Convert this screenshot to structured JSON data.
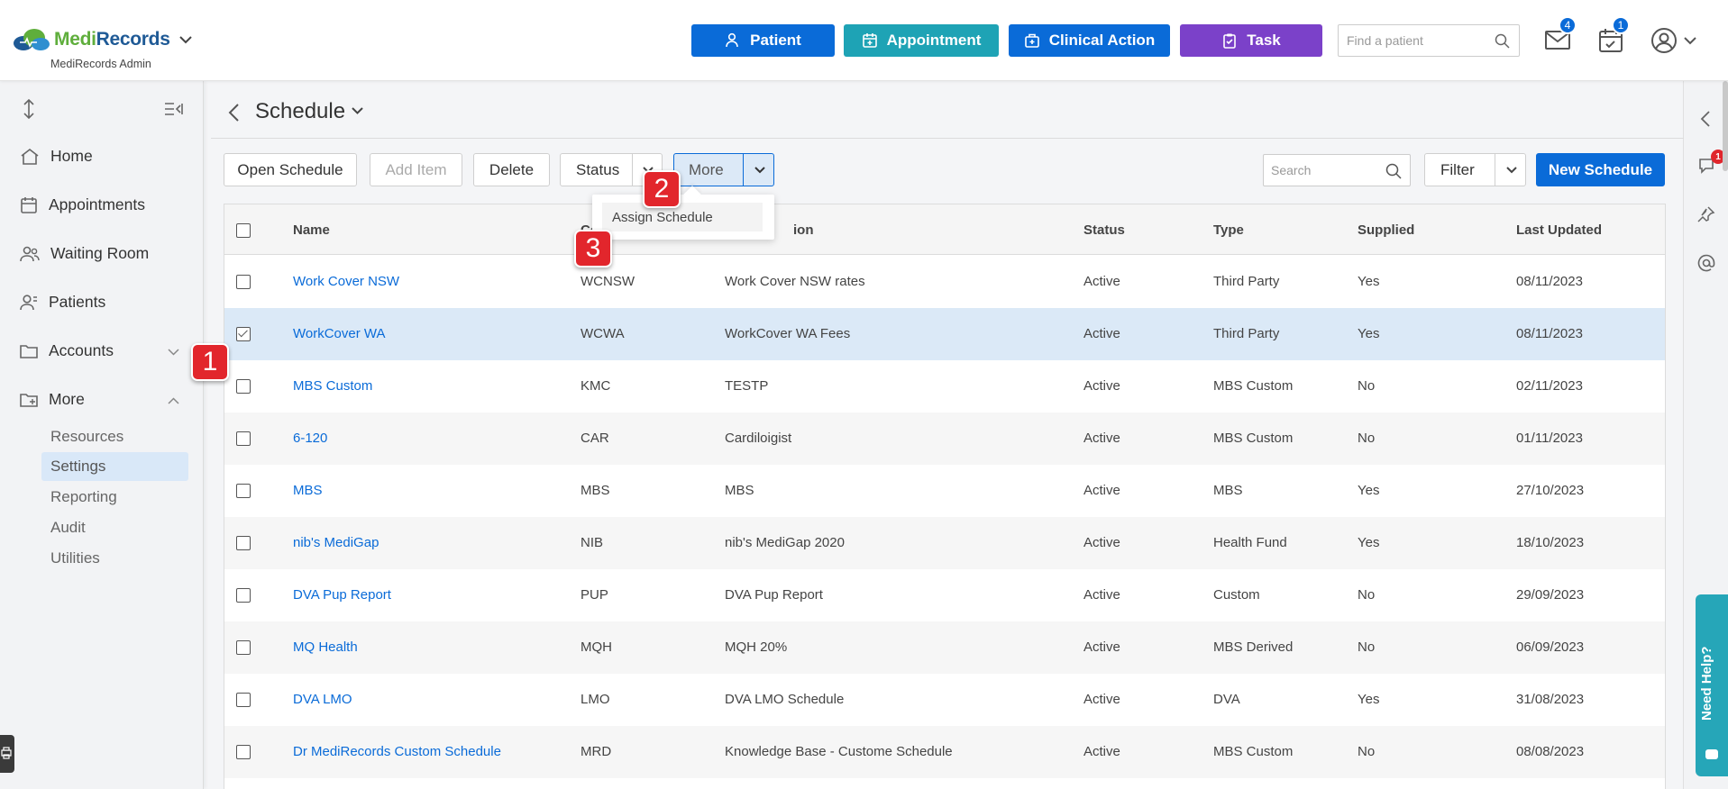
{
  "app": {
    "brand_part1": "Medi",
    "brand_part2": "Records",
    "subtitle": "MediRecords Admin"
  },
  "header": {
    "buttons": [
      {
        "label": "Patient",
        "color": "#0a6bd8"
      },
      {
        "label": "Appointment",
        "color": "#1ea3b5"
      },
      {
        "label": "Clinical Action",
        "color": "#0a6bd8"
      },
      {
        "label": "Task",
        "color": "#7b41c9"
      }
    ],
    "find_placeholder": "Find a patient",
    "mail_badge": "4",
    "calendar_badge": "1"
  },
  "sidebar": {
    "items": [
      {
        "label": "Home",
        "icon": "home-icon"
      },
      {
        "label": "Appointments",
        "icon": "calendar-icon"
      },
      {
        "label": "Waiting Room",
        "icon": "people-icon"
      },
      {
        "label": "Patients",
        "icon": "person-icon"
      },
      {
        "label": "Accounts",
        "icon": "folder-icon"
      },
      {
        "label": "More",
        "icon": "folder-plus-icon"
      }
    ],
    "sub_items": [
      {
        "label": "Resources"
      },
      {
        "label": "Settings"
      },
      {
        "label": "Reporting"
      },
      {
        "label": "Audit"
      },
      {
        "label": "Utilities"
      }
    ]
  },
  "page": {
    "title": "Schedule"
  },
  "toolbar": {
    "open_schedule": "Open Schedule",
    "add_item": "Add Item",
    "delete": "Delete",
    "status": "Status",
    "more": "More",
    "search_placeholder": "Search",
    "filter": "Filter",
    "new_schedule": "New Schedule"
  },
  "dropdown": {
    "item": "Assign Schedule"
  },
  "markers": [
    "1",
    "2",
    "3"
  ],
  "table": {
    "headers": {
      "name": "Name",
      "code": "Co",
      "description": "ion",
      "status": "Status",
      "type": "Type",
      "supplied": "Supplied",
      "last_updated": "Last Updated"
    },
    "rows": [
      {
        "name": "Work Cover NSW",
        "code": "WCNSW",
        "description": "Work Cover NSW rates",
        "status": "Active",
        "type": "Third Party",
        "supplied": "Yes",
        "updated": "08/11/2023",
        "checked": false
      },
      {
        "name": "WorkCover WA",
        "code": "WCWA",
        "description": "WorkCover WA Fees",
        "status": "Active",
        "type": "Third Party",
        "supplied": "Yes",
        "updated": "08/11/2023",
        "checked": true
      },
      {
        "name": "MBS Custom",
        "code": "KMC",
        "description": "TESTP",
        "status": "Active",
        "type": "MBS Custom",
        "supplied": "No",
        "updated": "02/11/2023",
        "checked": false
      },
      {
        "name": "6-120",
        "code": "CAR",
        "description": "Cardiloigist",
        "status": "Active",
        "type": "MBS Custom",
        "supplied": "No",
        "updated": "01/11/2023",
        "checked": false
      },
      {
        "name": "MBS",
        "code": "MBS",
        "description": "MBS",
        "status": "Active",
        "type": "MBS",
        "supplied": "Yes",
        "updated": "27/10/2023",
        "checked": false
      },
      {
        "name": "nib's MediGap",
        "code": "NIB",
        "description": "nib's MediGap 2020",
        "status": "Active",
        "type": "Health Fund",
        "supplied": "Yes",
        "updated": "18/10/2023",
        "checked": false
      },
      {
        "name": "DVA Pup Report",
        "code": "PUP",
        "description": "DVA Pup Report",
        "status": "Active",
        "type": "Custom",
        "supplied": "No",
        "updated": "29/09/2023",
        "checked": false
      },
      {
        "name": "MQ Health",
        "code": "MQH",
        "description": "MQH 20%",
        "status": "Active",
        "type": "MBS Derived",
        "supplied": "No",
        "updated": "06/09/2023",
        "checked": false
      },
      {
        "name": "DVA LMO",
        "code": "LMO",
        "description": "DVA LMO Schedule",
        "status": "Active",
        "type": "DVA",
        "supplied": "Yes",
        "updated": "31/08/2023",
        "checked": false
      },
      {
        "name": "Dr MediRecords Custom Schedule",
        "code": "MRD",
        "description": "Knowledge Base - Custome Schedule",
        "status": "Active",
        "type": "MBS Custom",
        "supplied": "No",
        "updated": "08/08/2023",
        "checked": false
      }
    ]
  },
  "help": {
    "label": "Need Help?"
  },
  "rail": {
    "chat_badge": "1"
  }
}
